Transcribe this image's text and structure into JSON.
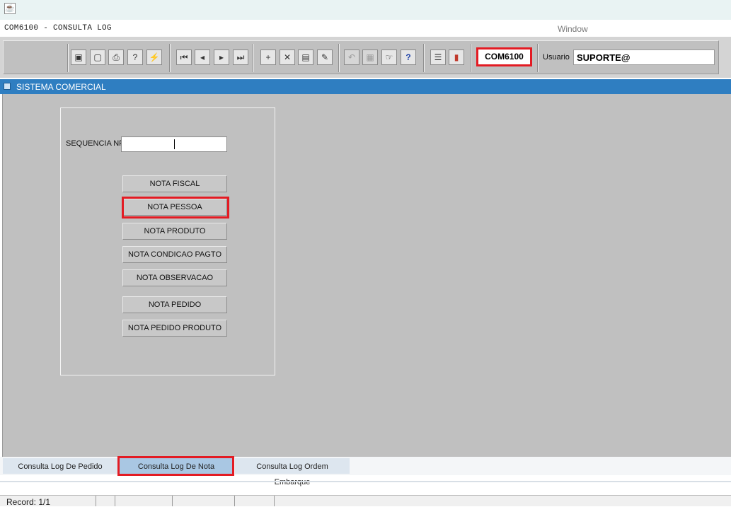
{
  "window": {
    "form_title": "COM6100 - CONSULTA LOG",
    "menu_window": "Window"
  },
  "toolbar": {
    "icons": [
      "save-icon",
      "exit-window-icon",
      "print-icon",
      "query-icon",
      "execute-query-icon",
      "first-record-icon",
      "prev-record-icon",
      "next-record-icon",
      "last-record-icon",
      "insert-record-icon",
      "delete-record-icon",
      "view-record-icon",
      "clear-icon",
      "undo-icon",
      "clipboard-icon",
      "list-values-icon",
      "help-icon",
      "menu-icon",
      "exit-app-icon"
    ],
    "form_code": "COM6100",
    "usuario_label": "Usuario",
    "usuario_value": "SUPORTE@"
  },
  "panel": {
    "title": "SISTEMA COMERCIAL"
  },
  "form": {
    "sequencia_label": "SEQUENCIA NF",
    "sequencia_value": "",
    "buttons": [
      "NOTA FISCAL",
      "NOTA PESSOA",
      "NOTA PRODUTO",
      "NOTA CONDICAO PAGTO",
      "NOTA OBSERVACAO",
      "NOTA PEDIDO",
      "NOTA PEDIDO PRODUTO"
    ]
  },
  "tabs": [
    "Consulta Log De Pedido",
    "Consulta Log De Nota",
    "Consulta Log Ordem Embarque"
  ],
  "status": {
    "record": "Record: 1/1"
  },
  "colors": {
    "highlight": "#e31b23",
    "title_bar": "#2f7ec1",
    "canvas": "#c0c0c0",
    "active_tab": "#a9c7e3"
  }
}
